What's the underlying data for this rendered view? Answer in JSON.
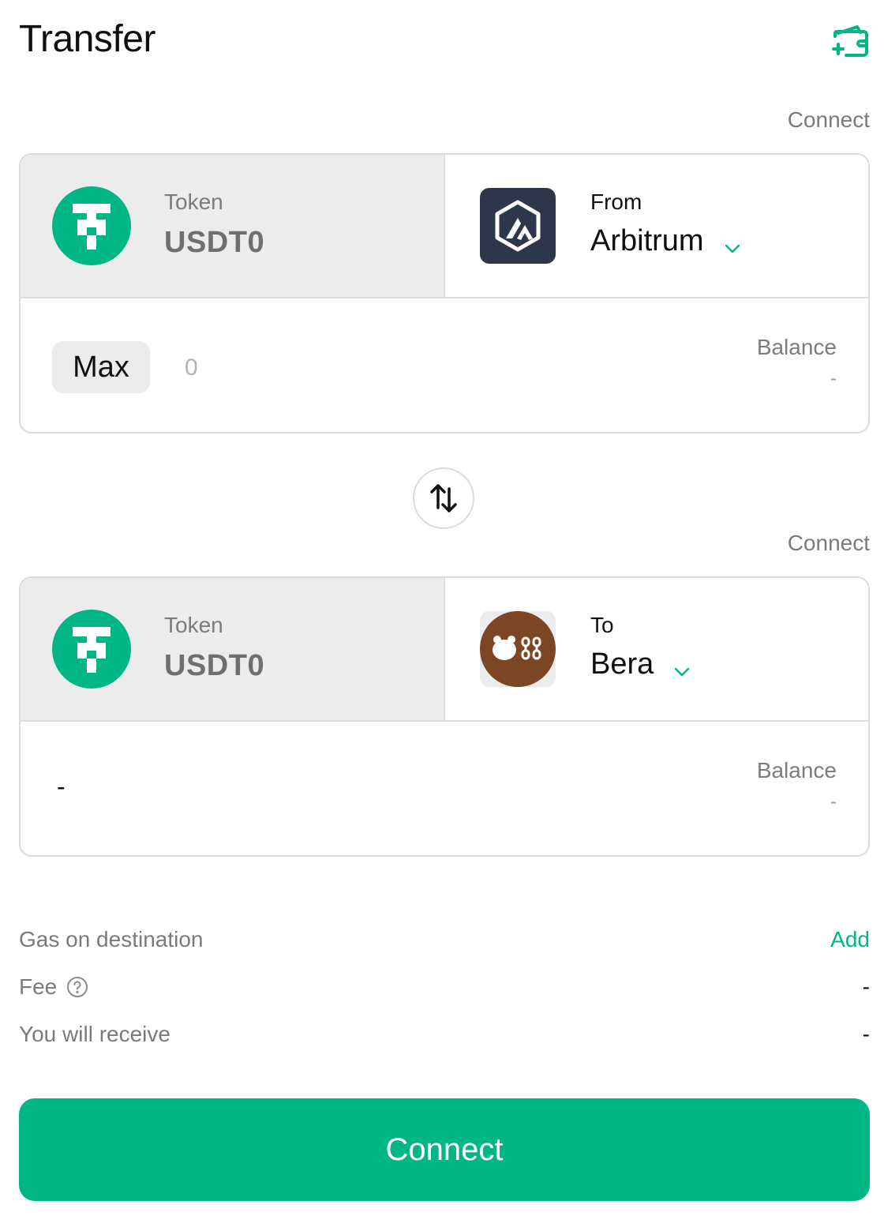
{
  "header": {
    "title": "Transfer",
    "wallet_icon": "wallet-add-icon"
  },
  "colors": {
    "accent": "#00b685",
    "arbitrum_bg": "#2d374b",
    "bera_bg": "#7c4624"
  },
  "source": {
    "connect_label": "Connect",
    "token_caption": "Token",
    "token_symbol": "USDT0",
    "chain_caption": "From",
    "chain_name": "Arbitrum",
    "max_label": "Max",
    "amount_placeholder": "0",
    "balance_label": "Balance",
    "balance_value": "-"
  },
  "swap": {
    "icon": "swap-arrows-icon"
  },
  "destination": {
    "connect_label": "Connect",
    "token_caption": "Token",
    "token_symbol": "USDT0",
    "chain_caption": "To",
    "chain_name": "Bera",
    "receive_value": "-",
    "balance_label": "Balance",
    "balance_value": "-"
  },
  "details": {
    "gas_label": "Gas on destination",
    "gas_action": "Add",
    "fee_label": "Fee",
    "fee_value": "-",
    "receive_label": "You will receive",
    "receive_value": "-"
  },
  "footer": {
    "button_label": "Connect"
  }
}
